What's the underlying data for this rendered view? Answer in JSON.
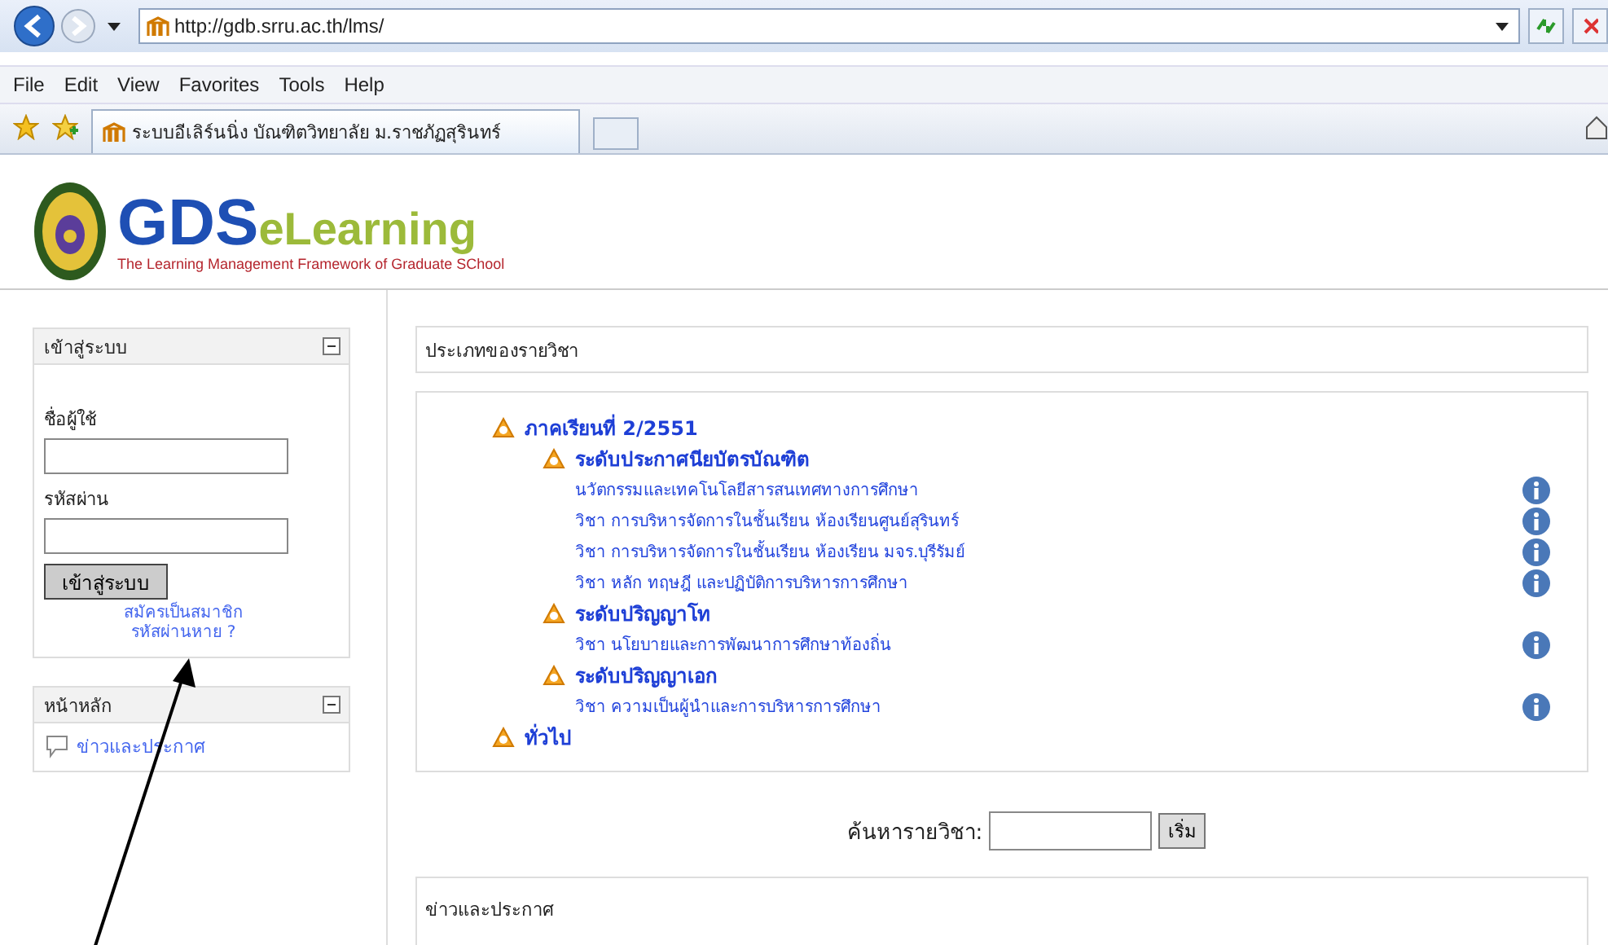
{
  "browser": {
    "address": "http://gdb.srru.ac.th/lms/",
    "menu": [
      "File",
      "Edit",
      "View",
      "Favorites",
      "Tools",
      "Help"
    ],
    "tabs": [
      {
        "title": "ระบบอีเลิร์นนิ่ง บัณฑิตวิทยาลัย ม.ราชภัฏสุรินทร์",
        "selected": true
      }
    ]
  },
  "logo": {
    "part1": "GDS",
    "part2": "eLearning",
    "tagline": "The Learning Management Framework of Graduate SChool"
  },
  "login_block": {
    "title": "เข้าสู่ระบบ",
    "username_label": "ชื่อผู้ใช้",
    "password_label": "รหัสผ่าน",
    "button": "เข้าสู่ระบบ",
    "links": [
      "สมัครเป็นสมาชิก",
      "รหัสผ่านหาย ?"
    ]
  },
  "main_menu_block": {
    "title": "หน้าหลัก",
    "items": [
      "ข่าวและประกาศ"
    ]
  },
  "categories_box": {
    "title": "ประเภทของรายวิชา"
  },
  "categories": [
    {
      "kind": "category",
      "name": "ภาคเรียนที่ 2/2551",
      "children": [
        {
          "kind": "category",
          "name": "ระดับประกาศนียบัตรบัณฑิต",
          "children": [
            {
              "kind": "course",
              "name": "นวัตกรรมและเทคโนโลยีสารสนเทศทางการศึกษา"
            },
            {
              "kind": "course",
              "name": "วิชา การบริหารจัดการในชั้นเรียน ห้องเรียนศูนย์สุรินทร์"
            },
            {
              "kind": "course",
              "name": "วิชา การบริหารจัดการในชั้นเรียน ห้องเรียน มจร.บุรีรัมย์"
            },
            {
              "kind": "course",
              "name": "วิชา หลัก ทฤษฎี และปฏิบัติการบริหารการศึกษา"
            }
          ]
        },
        {
          "kind": "category",
          "name": "ระดับปริญญาโท",
          "children": [
            {
              "kind": "course",
              "name": "วิชา นโยบายและการพัฒนาการศึกษาท้องถิ่น"
            }
          ]
        },
        {
          "kind": "category",
          "name": "ระดับปริญญาเอก",
          "children": [
            {
              "kind": "course",
              "name": "วิชา ความเป็นผู้นำและการบริหารการศึกษา"
            }
          ]
        }
      ]
    },
    {
      "kind": "category",
      "name": "ทั่วไป"
    }
  ],
  "course_search": {
    "label": "ค้นหารายวิชา:",
    "button": "เริ่ม"
  },
  "news_box": {
    "title": "ข่าวและประกาศ"
  }
}
